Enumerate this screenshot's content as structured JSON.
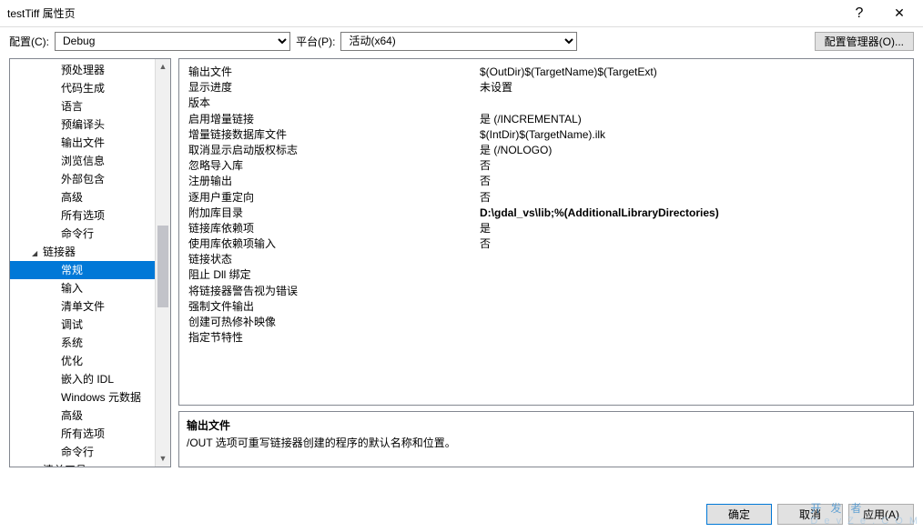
{
  "window": {
    "title": "testTiff 属性页",
    "help": "?",
    "close": "✕"
  },
  "top": {
    "config_label": "配置(C):",
    "config_value": "Debug",
    "platform_label": "平台(P):",
    "platform_value": "活动(x64)",
    "manager_btn": "配置管理器(O)..."
  },
  "tree": {
    "items_above": [
      "预处理器",
      "代码生成",
      "语言",
      "预编译头",
      "输出文件",
      "浏览信息",
      "外部包含",
      "高级",
      "所有选项",
      "命令行"
    ],
    "cat_linker": "链接器",
    "linker_children": [
      "常规",
      "输入",
      "清单文件",
      "调试",
      "系统",
      "优化",
      "嵌入的 IDL",
      "Windows 元数据",
      "高级",
      "所有选项",
      "命令行"
    ],
    "cat_manifest": "清单工具",
    "selected": "常规"
  },
  "props": [
    {
      "k": "输出文件",
      "v": "$(OutDir)$(TargetName)$(TargetExt)"
    },
    {
      "k": "显示进度",
      "v": "未设置"
    },
    {
      "k": "版本",
      "v": ""
    },
    {
      "k": "启用增量链接",
      "v": "是 (/INCREMENTAL)"
    },
    {
      "k": "增量链接数据库文件",
      "v": "$(IntDir)$(TargetName).ilk"
    },
    {
      "k": "取消显示启动版权标志",
      "v": "是 (/NOLOGO)"
    },
    {
      "k": "忽略导入库",
      "v": "否"
    },
    {
      "k": "注册输出",
      "v": "否"
    },
    {
      "k": "逐用户重定向",
      "v": "否"
    },
    {
      "k": "附加库目录",
      "v": "D:\\gdal_vs\\lib;%(AdditionalLibraryDirectories)",
      "bold": true
    },
    {
      "k": "链接库依赖项",
      "v": "是"
    },
    {
      "k": "使用库依赖项输入",
      "v": "否"
    },
    {
      "k": "链接状态",
      "v": ""
    },
    {
      "k": "阻止 Dll 绑定",
      "v": ""
    },
    {
      "k": "将链接器警告视为错误",
      "v": ""
    },
    {
      "k": "强制文件输出",
      "v": ""
    },
    {
      "k": "创建可热修补映像",
      "v": ""
    },
    {
      "k": "指定节特性",
      "v": ""
    }
  ],
  "desc": {
    "title": "输出文件",
    "body": "/OUT 选项可重写链接器创建的程序的默认名称和位置。"
  },
  "footer": {
    "ok": "确定",
    "cancel": "取消",
    "apply": "应用(A)"
  },
  "watermark": {
    "big": "开发者",
    "small": "D e v Z e . C O M"
  }
}
